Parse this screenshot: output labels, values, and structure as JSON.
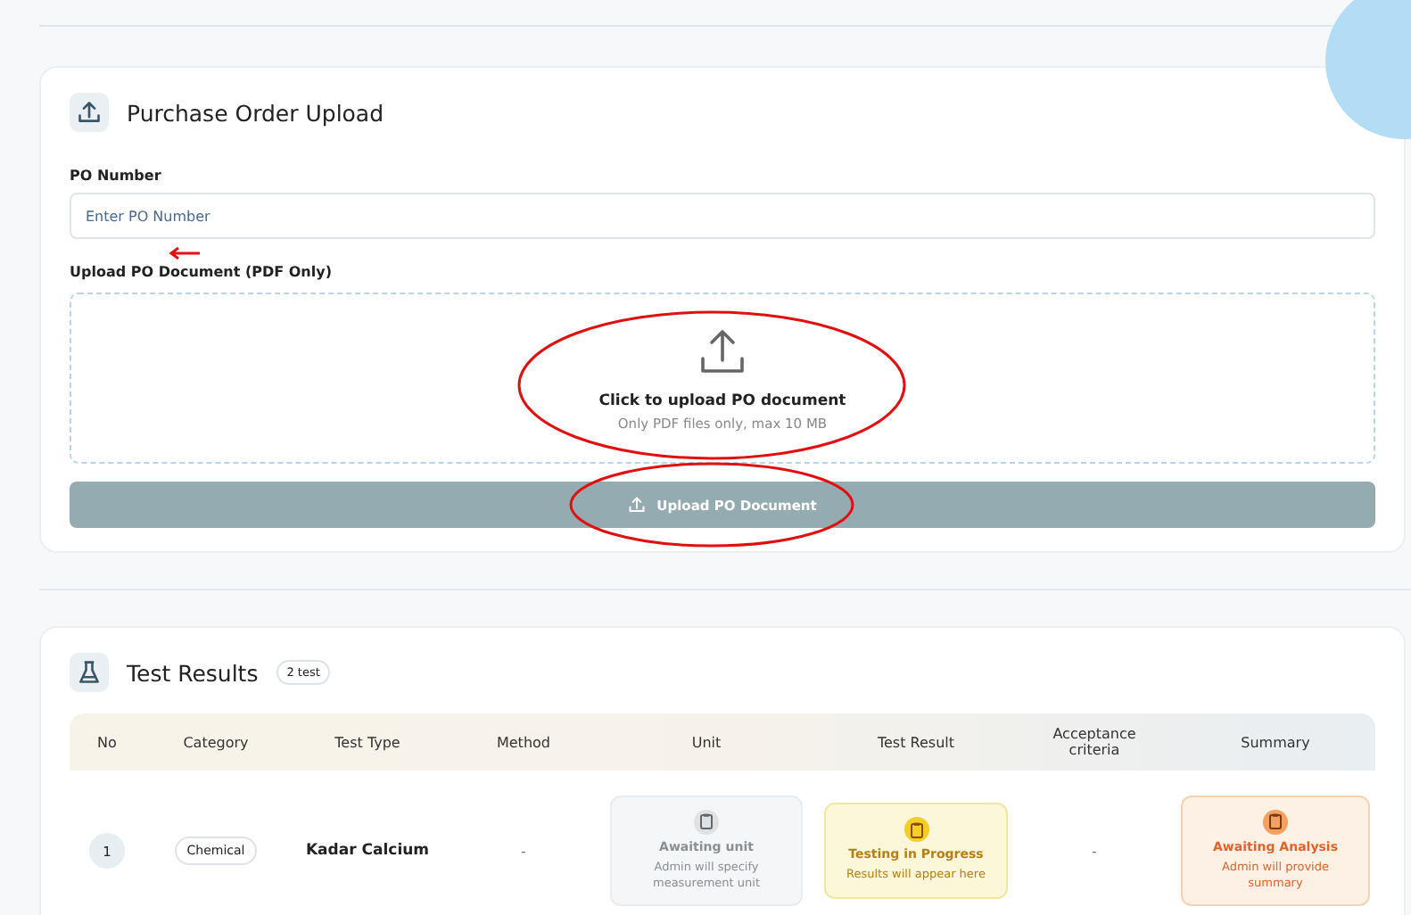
{
  "upload_card": {
    "title": "Purchase Order Upload",
    "po_label": "PO Number",
    "po_placeholder": "Enter PO Number",
    "doc_label": "Upload PO Document (PDF Only)",
    "drop_title": "Click to upload PO document",
    "drop_hint": "Only PDF files only, max 10 MB",
    "button": {
      "label": "Upload PO Document",
      "disabled": true
    }
  },
  "results_card": {
    "title": "Test Results",
    "count": "2 test",
    "columns": [
      "No",
      "Category",
      "Test Type",
      "Method",
      "Unit",
      "Test Result",
      "Acceptance criteria",
      "Summary"
    ],
    "rows": [
      {
        "no": "1",
        "category": "Chemical",
        "test_type": "Kadar Calcium",
        "method": "-",
        "unit": {
          "kind": "awaiting",
          "title": "Awaiting unit",
          "note": "Admin will specify measurement unit"
        },
        "result": {
          "kind": "progress",
          "title": "Testing in Progress",
          "note": "Results will appear here"
        },
        "acceptance": "-",
        "summary": {
          "kind": "analysis",
          "title": "Awaiting Analysis",
          "note": "Admin will provide summary"
        }
      }
    ]
  }
}
